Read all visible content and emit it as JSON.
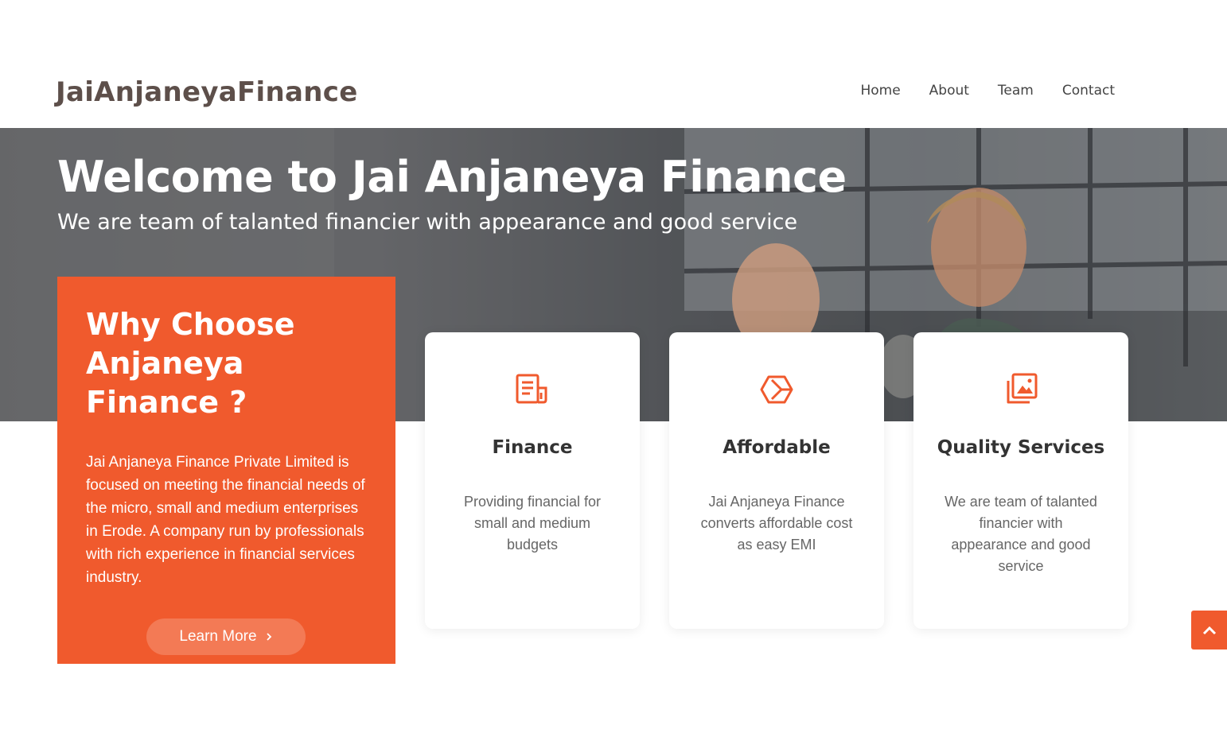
{
  "header": {
    "logo": "JaiAnjaneyaFinance",
    "nav": [
      "Home",
      "About",
      "Team",
      "Contact"
    ]
  },
  "hero": {
    "title": "Welcome to Jai Anjaneya Finance",
    "subtitle": "We are team of talanted financier with appearance and good service"
  },
  "why": {
    "title": "Why Choose Anjaneya Finance ?",
    "text": "Jai Anjaneya Finance Private Limited is focused on meeting the financial needs of the micro, small and medium enterprises in Erode. A company run by professionals with rich experience in financial services industry.",
    "button_label": "Learn More"
  },
  "cards": [
    {
      "icon": "document-icon",
      "title": "Finance",
      "text": "Providing financial for small and medium budgets"
    },
    {
      "icon": "cube-icon",
      "title": "Affordable",
      "text": "Jai Anjaneya Finance converts affordable cost as easy EMI"
    },
    {
      "icon": "images-icon",
      "title": "Quality Services",
      "text": "We are team of talanted financier with appearance and good service"
    }
  ],
  "colors": {
    "accent": "#f05a2d",
    "button": "#f37a55",
    "logo": "#5d4f4a"
  },
  "icons": {
    "back_to_top": "chevron-up-icon",
    "button_arrow": "chevron-right-icon"
  }
}
